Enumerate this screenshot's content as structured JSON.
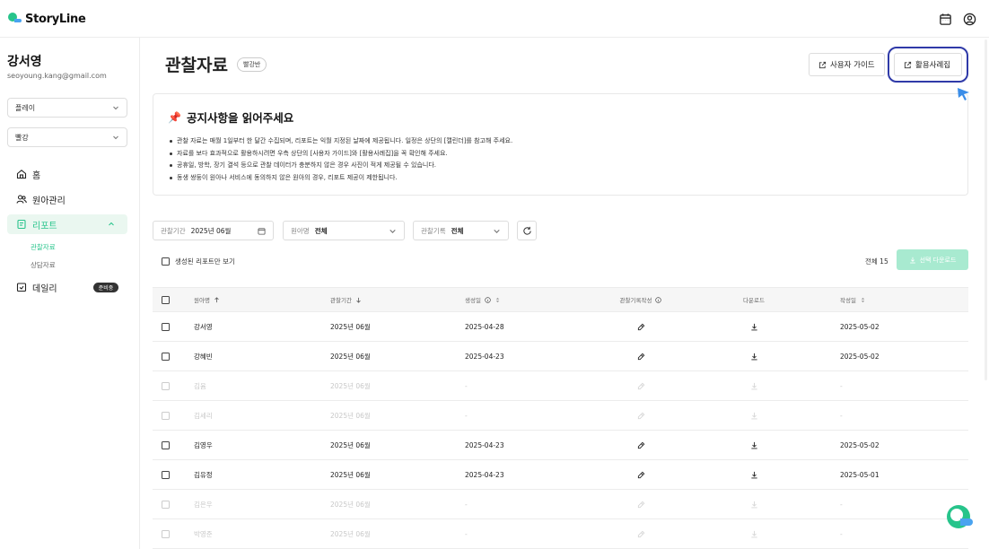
{
  "app": {
    "name": "StoryLine"
  },
  "user": {
    "name": "강서영",
    "email": "seoyoung.kang@gmail.com"
  },
  "sidebar": {
    "select_school": "플레이",
    "select_class": "빨강",
    "nav": [
      {
        "label": "홈",
        "icon": "home-icon"
      },
      {
        "label": "원아관리",
        "icon": "users-icon"
      },
      {
        "label": "리포트",
        "icon": "report-icon"
      },
      {
        "label": "데일리",
        "icon": "daily-icon",
        "badge": "준비중"
      }
    ],
    "report_sub": [
      "관찰자료",
      "상담자료"
    ]
  },
  "header": {
    "title": "관찰자료",
    "class_badge": "빨강반",
    "guide_button": "사용자 가이드",
    "case_button": "활용사례집"
  },
  "notice": {
    "title": "공지사항을 읽어주세요",
    "items": [
      "관찰 자료는 매월 1일부터 한 달간 수집되며, 리포트는 익월 지정된 날짜에 제공됩니다. 일정은 상단의 [캘린더]를 참고해 주세요.",
      "자료를 보다 효과적으로 활용하시려면 우측 상단의 [사용자 가이드]와 [활용사례집]을 꼭 확인해 주세요.",
      "공휴일, 방학, 장기 결석 등으로 관찰 데이터가 충분하지 않은 경우 사진이 적게 제공될 수 있습니다.",
      "동생 쌍둥이 원아나 서비스에 동의하지 않은 원아의 경우, 리포트 제공이 제한됩니다."
    ]
  },
  "filters": {
    "period_label": "관찰기간",
    "period_value": "2025년 06월",
    "child_label": "원아명",
    "child_value": "전체",
    "record_label": "관찰기록",
    "record_value": "전체"
  },
  "toolbar": {
    "only_generated": "생성된 리포트만 보기",
    "total": "전체 15",
    "download_selected": "선택 다운로드"
  },
  "table": {
    "headers": {
      "name": "원아명",
      "period": "관찰기간",
      "birth": "생성일",
      "write": "관찰기록작성",
      "download": "다운로드",
      "date": "작성일"
    },
    "rows": [
      {
        "name": "강서영",
        "period": "2025년 06월",
        "birth": "2025-04-28",
        "date": "2025-05-02",
        "dim": false
      },
      {
        "name": "강혜빈",
        "period": "2025년 06월",
        "birth": "2025-04-23",
        "date": "2025-05-02",
        "dim": false
      },
      {
        "name": "김윰",
        "period": "2025년 06월",
        "birth": "-",
        "date": "-",
        "dim": true
      },
      {
        "name": "김세리",
        "period": "2025년 06월",
        "birth": "-",
        "date": "-",
        "dim": true
      },
      {
        "name": "김영우",
        "period": "2025년 06월",
        "birth": "2025-04-23",
        "date": "2025-05-02",
        "dim": false
      },
      {
        "name": "김유정",
        "period": "2025년 06월",
        "birth": "2025-04-23",
        "date": "2025-05-01",
        "dim": false
      },
      {
        "name": "김은우",
        "period": "2025년 06월",
        "birth": "-",
        "date": "-",
        "dim": true
      },
      {
        "name": "박영준",
        "period": "2025년 06월",
        "birth": "-",
        "date": "-",
        "dim": true
      }
    ]
  },
  "colors": {
    "brand": "#27c48b",
    "highlight": "#2f3aa8"
  }
}
